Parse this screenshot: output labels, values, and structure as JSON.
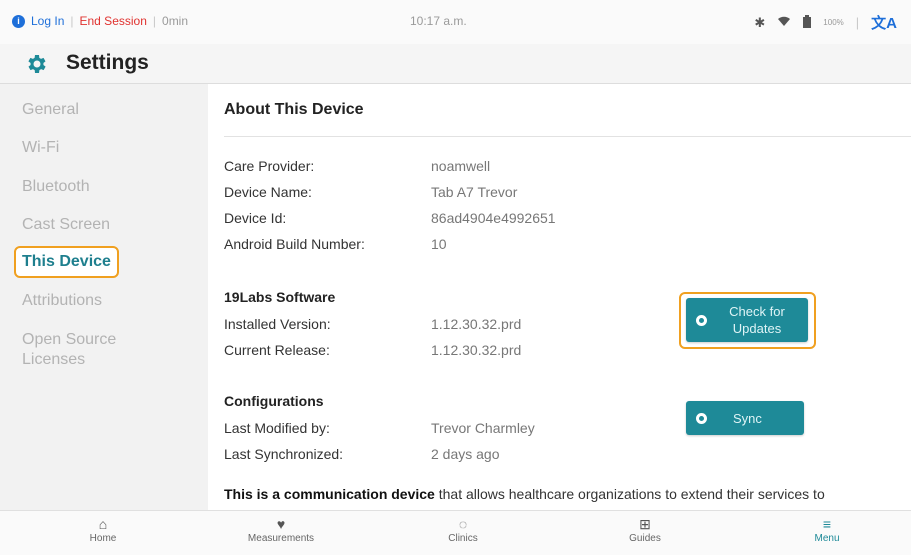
{
  "status_bar": {
    "login": "Log In",
    "end_session": "End Session",
    "duration": "0min",
    "time": "10:17 a.m.",
    "battery": "100%"
  },
  "header": {
    "title": "Settings",
    "icon": "gear-icon"
  },
  "sidebar": {
    "items": [
      {
        "label": "General"
      },
      {
        "label": "Wi-Fi"
      },
      {
        "label": "Bluetooth"
      },
      {
        "label": "Cast Screen"
      },
      {
        "label": "This Device",
        "active": true
      },
      {
        "label": "Attributions"
      },
      {
        "label": "Open Source Licenses"
      }
    ]
  },
  "main": {
    "title": "About This Device",
    "device": [
      {
        "label": "Care Provider:",
        "value": "noamwell"
      },
      {
        "label": "Device Name:",
        "value": "Tab A7 Trevor"
      },
      {
        "label": "Device Id:",
        "value": "86ad4904e4992651"
      },
      {
        "label": "Android Build Number:",
        "value": "10"
      }
    ],
    "software": {
      "heading": "19Labs Software",
      "rows": [
        {
          "label": "Installed Version:",
          "value": "1.12.30.32.prd"
        },
        {
          "label": "Current Release:",
          "value": "1.12.30.32.prd"
        }
      ],
      "button": "Check for Updates"
    },
    "configurations": {
      "heading": "Configurations",
      "rows": [
        {
          "label": "Last Modified by:",
          "value": "Trevor Charmley"
        },
        {
          "label": "Last Synchronized:",
          "value": "2 days ago"
        }
      ],
      "button": "Sync"
    },
    "description_bold": "This is a communication device",
    "description_rest": " that allows healthcare organizations to extend their services to"
  },
  "bottom_nav": [
    {
      "label": "Home",
      "icon": "home-icon"
    },
    {
      "label": "Measurements",
      "icon": "heart-pulse-icon"
    },
    {
      "label": "Clinics",
      "icon": "chat-icon"
    },
    {
      "label": "Guides",
      "icon": "plus-square-icon"
    },
    {
      "label": "Menu",
      "icon": "menu-icon",
      "active": true
    }
  ],
  "colors": {
    "accent": "#1e8a98",
    "highlight": "#f0a020",
    "danger": "#e0322f",
    "link": "#1e6fd9"
  }
}
